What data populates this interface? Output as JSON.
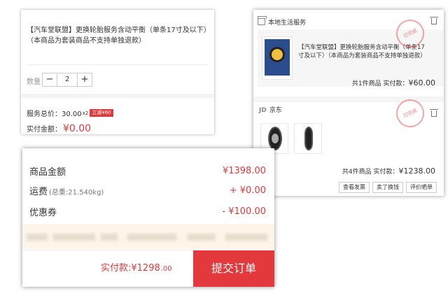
{
  "colors": {
    "accent": "#e4393c",
    "band": "#f4f4f4",
    "promo_bg": "#fdf6e8"
  },
  "card_a": {
    "title": "【汽车堂联盟】更换轮胎服务含动平衡（单条17寸及以下）（本商品为套装商品不支持单独退款）",
    "quantity_label": "数量",
    "quantity_minus": "−",
    "quantity_value": "2",
    "quantity_plus": "+",
    "service_total_label": "服务总价：30.00",
    "service_multiplier": "x2",
    "discount_badge": "立减¥60",
    "actual_pay_label": "实付金额：",
    "actual_pay_value": "¥0.00"
  },
  "card_b": {
    "shop1_name": "本地生活服务",
    "shop1_stamp": "已完成",
    "item_title": "【汽车堂联盟】更换轮胎服务含动平衡（单条17寸及以下）（本商品为套装商品不支持单独退款）",
    "shop1_summary_label": "共1件商品  实付款：",
    "shop1_summary_value": "¥60.00",
    "shop2_logo": "JD",
    "shop2_name": "京东",
    "shop2_stamp": "已完成",
    "shop2_summary_label": "共4件商品  实付款：",
    "shop2_summary_value": "¥1238.00",
    "buttons": [
      "查看发票",
      "卖了换钱",
      "评价晒单"
    ]
  },
  "card_c": {
    "goods_amount_label": "商品金额",
    "goods_amount_value": "¥1398.00",
    "freight_label": "运费",
    "freight_weight": "(总重:21.540kg)",
    "freight_value": "+ ¥0.00",
    "coupon_label": "优惠券",
    "coupon_value": "- ¥100.00",
    "paid_label": "实付款:¥1298",
    "paid_decimal": ".00",
    "submit_label": "提交订单"
  }
}
